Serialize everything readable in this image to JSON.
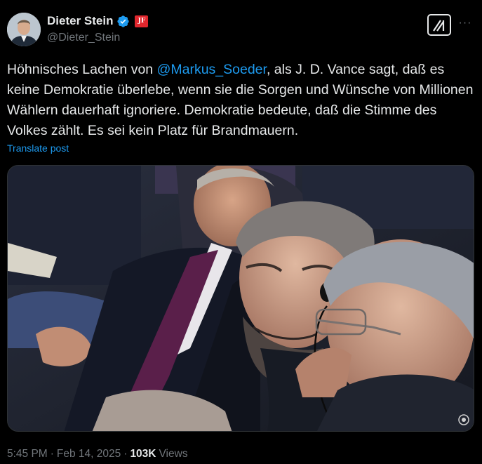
{
  "author": {
    "display_name": "Dieter Stein",
    "handle": "@Dieter_Stein",
    "verified_icon": "verified-badge-icon",
    "affiliation_badge": "JF",
    "affiliation_color": "#e1262d"
  },
  "actions": {
    "grok_icon": "grok-icon",
    "more_icon": "more-options-icon",
    "more_glyph": "···"
  },
  "post": {
    "text_before": "Höhnisches Lachen von ",
    "mention": "@Markus_Soeder",
    "text_after": ", als J. D. Vance sagt, daß es keine Demokratie überlebe, wenn sie die Sorgen und Wünsche von Millionen Wählern dauerhaft ignoriere. Demokratie bedeute, daß die Stimme des Volkes zählt. Es sei kein Platz für Brandmauern.",
    "translate_label": "Translate post"
  },
  "meta": {
    "time": "5:45 PM",
    "sep1": "·",
    "date": "Feb 14, 2025",
    "sep2": "·",
    "views_count": "103K",
    "views_label": "Views"
  },
  "colors": {
    "background": "#000000",
    "text": "#e7e9ea",
    "secondary": "#71767b",
    "link": "#1d9bf0"
  }
}
